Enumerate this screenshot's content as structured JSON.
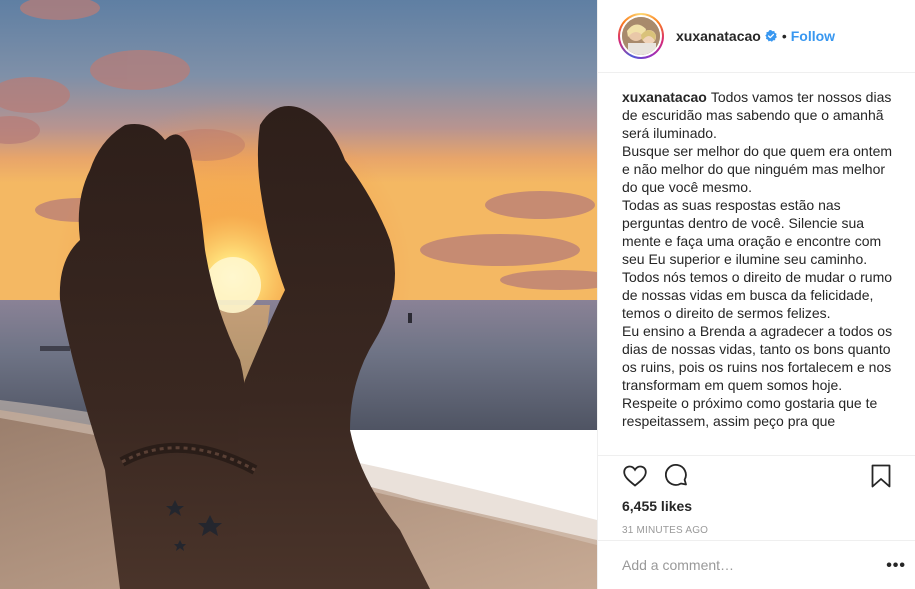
{
  "post": {
    "image_alt_icon": "photo-sunset-hands",
    "account": {
      "username": "xuxanatacao",
      "verified_icon": "verified-badge-icon",
      "separator": "•",
      "follow_label": "Follow"
    },
    "caption": {
      "username": "xuxanatacao",
      "paragraphs": [
        "Todos vamos ter nossos dias de escuridão mas sabendo que o amanhã será iluminado.",
        "Busque ser melhor do que quem era ontem e não melhor do que ninguém mas melhor do que você mesmo.",
        "Todas as suas respostas estão nas perguntas dentro de você. Silencie sua mente e faça uma oração e encontre com seu Eu superior e ilumine seu caminho.",
        "Todos nós temos o direito de mudar o rumo de nossas vidas em busca da felicidade, temos o direito de sermos felizes.",
        "Eu ensino a Brenda a agradecer a todos os dias de nossas vidas, tanto os bons quanto os ruins, pois os ruins nos fortalecem e nos transformam em quem somos hoje.",
        "Respeite o próximo como gostaria que te respeitassem, assim peço pra que"
      ]
    },
    "actions": {
      "like_icon": "heart-icon",
      "comment_icon": "comment-icon",
      "save_icon": "bookmark-icon",
      "likes": "6,455 likes",
      "time_ago": "31 MINUTES AGO"
    },
    "comment": {
      "placeholder": "Add a comment…",
      "more_label": "•••"
    },
    "colors": {
      "link_blue": "#3897f0",
      "text": "#262626",
      "muted": "#999999",
      "border": "#efefef"
    }
  }
}
